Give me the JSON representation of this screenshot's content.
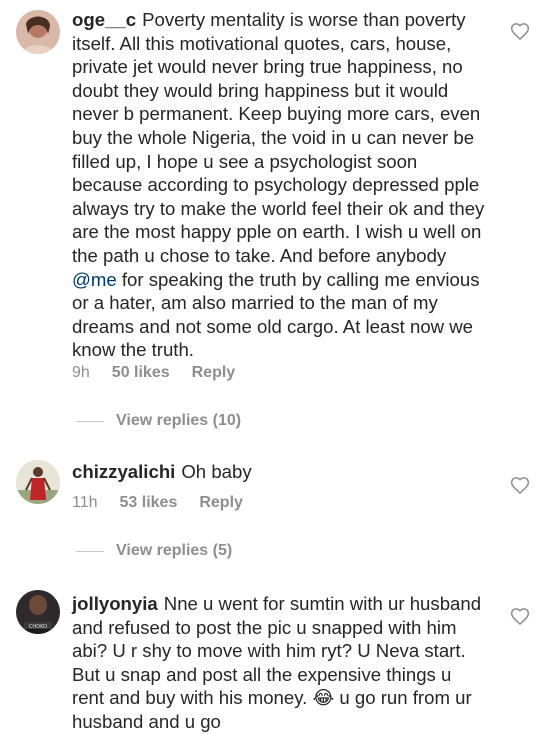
{
  "comments": [
    {
      "username": "oge__c",
      "text_before_mention": "Poverty mentality is worse than poverty itself.  All this motivational quotes,  cars, house,  private jet would never bring true happiness,  no doubt they would bring happiness but it would never b permanent. Keep buying more cars, even buy the whole Nigeria,  the void in u can never be filled up, I hope u see a psychologist soon because according to psychology depressed pple always try to  make the world feel their ok and they are the most happy pple on earth.  I wish u well on the path u chose to take. And before anybody ",
      "mention": "@me",
      "text_after_mention": " for speaking the truth by calling me envious or a hater, am also married to the man of my dreams and not some old cargo. At least now we know the truth.",
      "time": "9h",
      "likes": "50 likes",
      "reply": "Reply",
      "view_replies": "View replies (10)"
    },
    {
      "username": "chizzyalichi",
      "text": "Oh baby",
      "time": "11h",
      "likes": "53 likes",
      "reply": "Reply",
      "view_replies": "View replies (5)"
    },
    {
      "username": "jollyonyia",
      "text": "Nne u went for sumtin with ur husband and refused to post the pic u snapped with him abi? U r shy to move with him ryt? U Neva start. But u snap and post all the expensive things u rent and buy with his money. 😂 u go run from ur husband and u go",
      "avatar_caption": "CHOKO"
    }
  ],
  "colors": {
    "text": "#262626",
    "meta": "#8e8e8e",
    "mention": "#00376b",
    "divider": "#c7c7c7"
  },
  "icons": {
    "like": "heart-outline-icon"
  }
}
